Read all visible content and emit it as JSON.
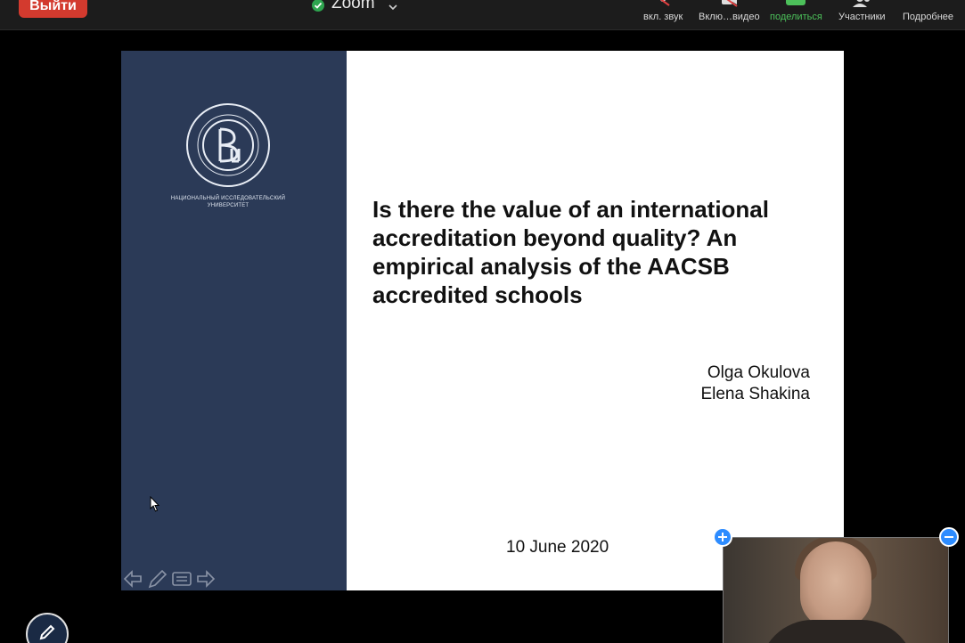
{
  "toolbar": {
    "leave_label": "Выйти",
    "app_title": "Zoom",
    "tools": {
      "audio": "вкл. звук",
      "video": "Вклю…видео",
      "share": "поделиться",
      "participants": "Участники",
      "more": "Подробнее"
    },
    "share_color": "#4cc05a",
    "leave_color": "#d33a2e"
  },
  "slide": {
    "university_name_line1": "НАЦИОНАЛЬНЫЙ ИССЛЕДОВАТЕЛЬСКИЙ",
    "university_name_line2": "УНИВЕРСИТЕТ",
    "logo_letter": "Вш",
    "title": "Is there the value of an international accreditation beyond quality? An empirical analysis of the AACSB accredited schools",
    "author1": "Olga Okulova",
    "author2": "Elena Shakina",
    "date": "10 June 2020",
    "left_panel_color": "#2b3a57"
  },
  "icons": {
    "shield": "shield-check-icon",
    "chevron": "chevron-down-icon",
    "mic": "mic-muted-icon",
    "camera": "camera-off-icon",
    "share": "share-screen-icon",
    "participants": "participants-icon",
    "more": "more-icon",
    "annotate": "pencil-icon",
    "zoom_in": "plus-icon",
    "zoom_out": "minus-icon"
  }
}
